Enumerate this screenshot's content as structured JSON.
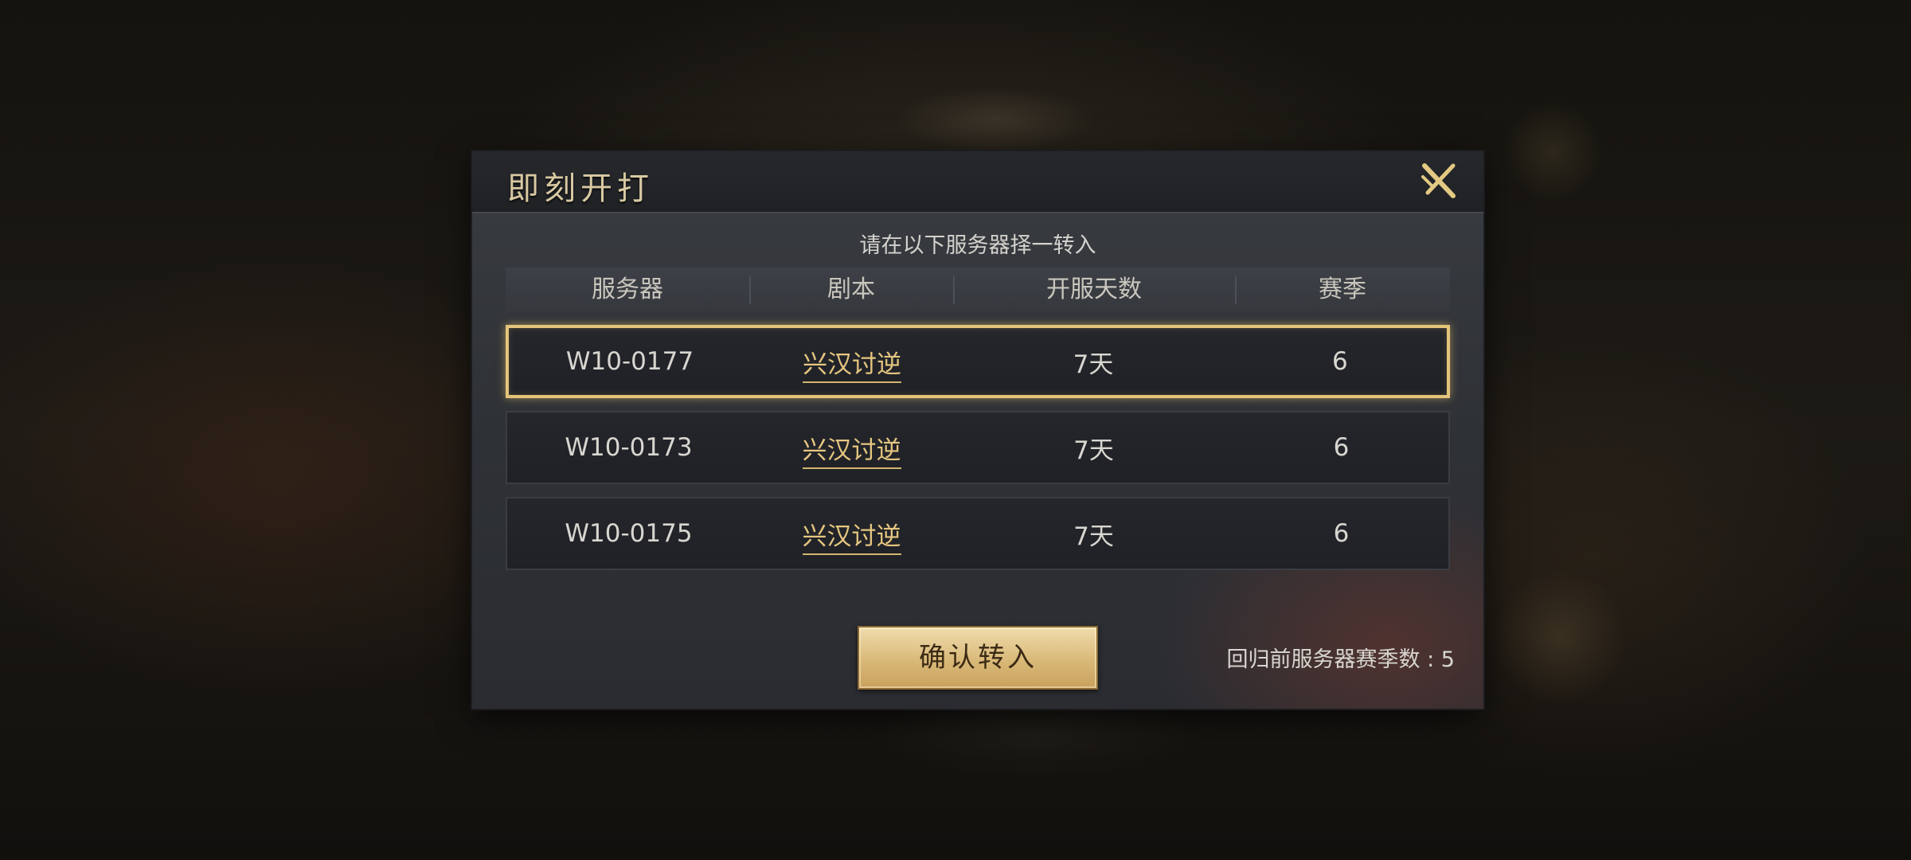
{
  "dialog": {
    "title": "即刻开打",
    "subtitle": "请在以下服务器择一转入",
    "close_icon": "close-icon"
  },
  "table": {
    "headers": [
      "服务器",
      "剧本",
      "开服天数",
      "赛季"
    ],
    "rows": [
      {
        "server": "W10-0177",
        "script": "兴汉讨逆",
        "days": "7天",
        "season": "6",
        "selected": true
      },
      {
        "server": "W10-0173",
        "script": "兴汉讨逆",
        "days": "7天",
        "season": "6",
        "selected": false
      },
      {
        "server": "W10-0175",
        "script": "兴汉讨逆",
        "days": "7天",
        "season": "6",
        "selected": false
      }
    ]
  },
  "footer": {
    "confirm_label": "确认转入",
    "return_info": "回归前服务器赛季数 : 5"
  },
  "colors": {
    "accent_gold": "#e3c47a",
    "script_link": "#e6c680"
  }
}
